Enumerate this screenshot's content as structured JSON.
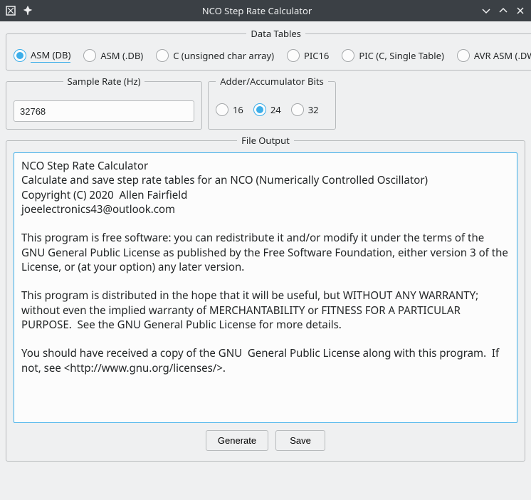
{
  "window": {
    "title": "NCO Step Rate Calculator"
  },
  "dataTables": {
    "legend": "Data Tables",
    "options": [
      {
        "label": "ASM (DB)",
        "selected": true
      },
      {
        "label": "ASM (.DB)",
        "selected": false
      },
      {
        "label": "C (unsigned char array)",
        "selected": false
      },
      {
        "label": "PIC16",
        "selected": false
      },
      {
        "label": "PIC (C, Single Table)",
        "selected": false
      },
      {
        "label": "AVR ASM (.DW)",
        "selected": false
      }
    ]
  },
  "sampleRate": {
    "legend": "Sample Rate (Hz)",
    "value": "32768"
  },
  "accumBits": {
    "legend": "Adder/Accumulator Bits",
    "options": [
      {
        "label": "16",
        "selected": false
      },
      {
        "label": "24",
        "selected": true
      },
      {
        "label": "32",
        "selected": false
      }
    ]
  },
  "fileOutput": {
    "legend": "File Output",
    "text": "NCO Step Rate Calculator\nCalculate and save step rate tables for an NCO (Numerically Controlled Oscillator)\nCopyright (C) 2020  Allen Fairfield\njoeelectronics43@outlook.com\n\nThis program is free software: you can redistribute it and/or modify it under the terms of the GNU General Public License as published by the Free Software Foundation, either version 3 of the License, or (at your option) any later version.\n\nThis program is distributed in the hope that it will be useful, but WITHOUT ANY WARRANTY; without even the implied warranty of MERCHANTABILITY or FITNESS FOR A PARTICULAR PURPOSE.  See the GNU General Public License for more details.\n\nYou should have received a copy of the GNU  General Public License along with this program.  If not, see <http://www.gnu.org/licenses/>."
  },
  "buttons": {
    "generate": "Generate",
    "save": "Save"
  }
}
